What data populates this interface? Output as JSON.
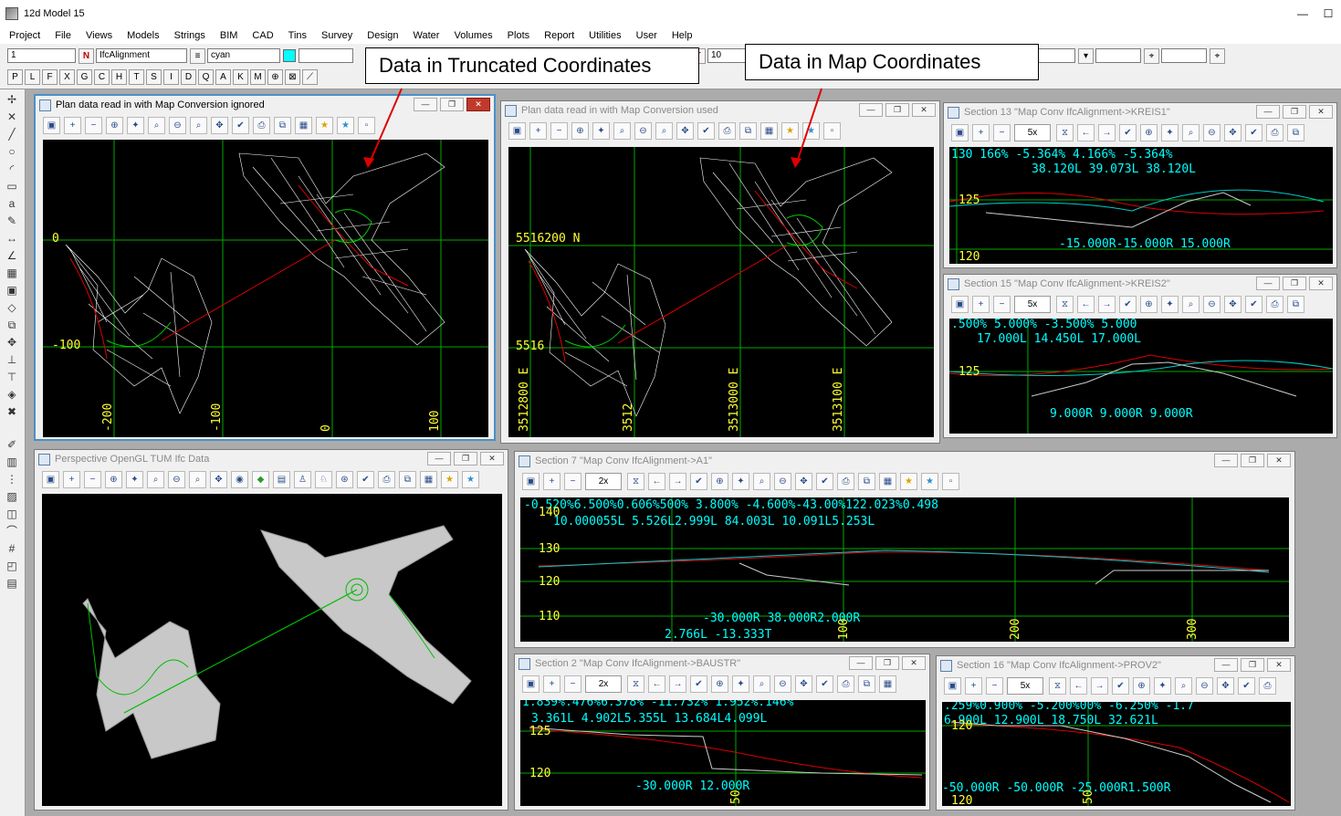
{
  "app": {
    "title": "12d Model  15",
    "min": "—",
    "max": "☐"
  },
  "menu": [
    "Project",
    "File",
    "Views",
    "Models",
    "Strings",
    "BIM",
    "CAD",
    "Tins",
    "Survey",
    "Design",
    "Water",
    "Volumes",
    "Plots",
    "Report",
    "Utilities",
    "User",
    "Help"
  ],
  "toolbar": {
    "field1": "1",
    "model_field": "IfcAlignment",
    "colour_field": "cyan",
    "num_field": "10",
    "letters": [
      "P",
      "L",
      "F",
      "X",
      "G",
      "C",
      "H",
      "T",
      "S",
      "I",
      "D",
      "Q",
      "A",
      "K",
      "M"
    ]
  },
  "callouts": {
    "truncated": "Data in Truncated Coordinates",
    "map": "Data in Map Coordinates"
  },
  "windows": {
    "plan_ignored": {
      "title": "Plan data read in with Map Conversion ignored",
      "labels": {
        "y0": "0",
        "y100": "-100",
        "x200": "-200",
        "x100": "-100",
        "x0": "0",
        "x100p": "100"
      }
    },
    "plan_used": {
      "title": "Plan data read in with Map Conversion used",
      "labels": {
        "n": "5516200 N",
        "n2": "5516",
        "e1": "3512800 E",
        "e2": "3512",
        "e3": "3513000 E",
        "e4": "3513100 E"
      }
    },
    "section13": {
      "title": "Section 13 \"Map Conv IfcAlignment->KREIS1\"",
      "zoom": "5x",
      "grades": "130 166%      -5.364%       4.166%       -5.364%",
      "lengths": "38.120L  39.073L      38.120L",
      "level": "125",
      "radii": "-15.000R-15.000R 15.000R",
      "corner": "120"
    },
    "section15": {
      "title": "Section 15 \"Map Conv IfcAlignment->KREIS2\"",
      "zoom": "5x",
      "grades": ".500%      5.000%           -3.500%          5.000",
      "lengths": "17.000L        14.450L          17.000L",
      "level": "125",
      "radii": "9.000R      9.000R      9.000R"
    },
    "opengl": {
      "title": "Perspective OpenGL TUM Ifc Data"
    },
    "section7": {
      "title": "Section 7 \"Map Conv IfcAlignment->A1\"",
      "zoom": "2x",
      "grades": "-0.520%6.500%0.606%500%        3.800%                    -4.600%-43.00%122.023%0.498",
      "lengths": "10.000055L 5.526L2.999L             84.003L                   10.091L5.253L",
      "l140": "140",
      "l130": "130",
      "l120": "120",
      "l110": "110",
      "radii": "-30.000R                             38.000R2.000R",
      "bottom": "2.766L  -13.333T",
      "ch100": "100",
      "ch200": "200",
      "ch300": "300"
    },
    "section2": {
      "title": "Section 2 \"Map Conv IfcAlignment->BAUSTR\"",
      "zoom": "2x",
      "grades": "1.839%.476%6.378%      -11.732%           1.952%.146%",
      "lengths": "3.361L 4.902L5.355L            13.684L4.099L",
      "l125": "125",
      "l120": "120",
      "radii": "-30.000R          12.000R",
      "ch50": "50"
    },
    "section16": {
      "title": "Section 16 \"Map Conv IfcAlignment->PROV2\"",
      "zoom": "5x",
      "grades": ".259%0.900%  -5.200%00%   -6.250%      -1.7",
      "lengths": "6.900L  12.900L   18.750L      32.621L",
      "l120top": "120",
      "radii": "-50.000R    -50.000R        -25.000R1.500R",
      "l120bot": "120",
      "ch50": "50"
    }
  }
}
